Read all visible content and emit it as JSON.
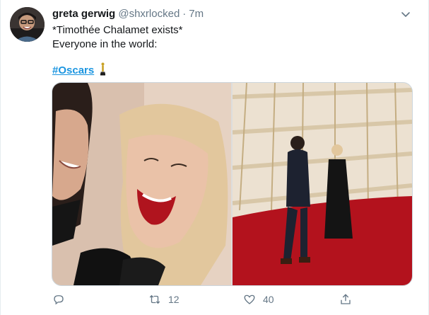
{
  "user": {
    "display_name": "greta gerwig",
    "handle": "@shxrlocked",
    "separator": "·",
    "time": "7m"
  },
  "tweet": {
    "line1": "*Timothée Chalamet exists*",
    "line2": "Everyone in the world:",
    "hashtag": "#Oscars",
    "hashtag_emoji_icon": "oscar-statuette-icon"
  },
  "media": {
    "images": [
      {
        "icon": "photo-closeup-laughing-couple"
      },
      {
        "icon": "photo-red-carpet-couple"
      }
    ]
  },
  "actions": {
    "reply": {
      "icon": "reply-icon",
      "count": ""
    },
    "retweet": {
      "icon": "retweet-icon",
      "count": "12"
    },
    "like": {
      "icon": "heart-icon",
      "count": "40"
    },
    "share": {
      "icon": "share-icon",
      "count": ""
    }
  },
  "colors": {
    "link": "#1b95e0",
    "muted": "#657786",
    "text": "#14171a",
    "border": "#e6ecf0"
  }
}
